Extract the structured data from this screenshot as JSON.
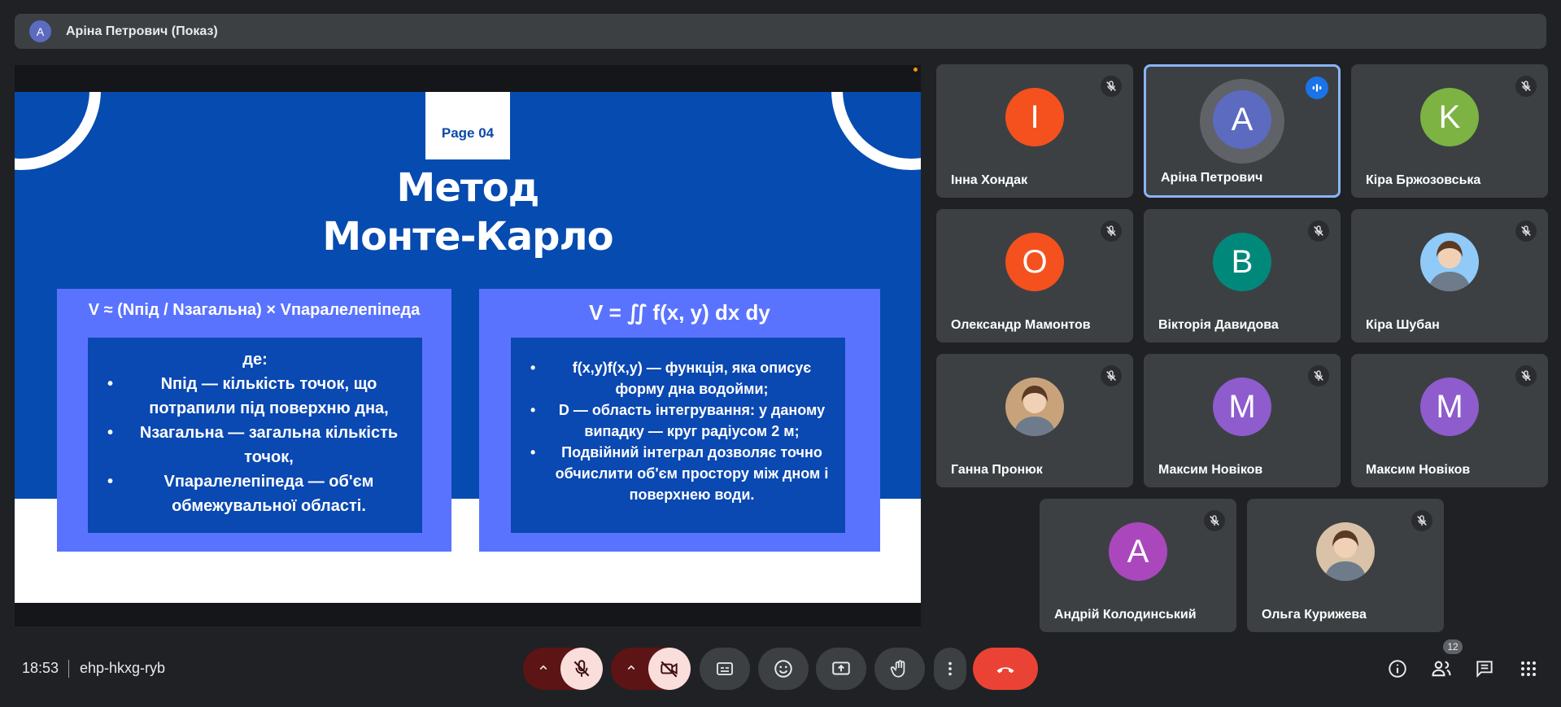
{
  "presenter_bar": {
    "avatar_letter": "A",
    "title": "Аріна Петрович (Показ)"
  },
  "slide": {
    "page_label": "Page 04",
    "title_line1": "Метод",
    "title_line2": "Монте-Карло",
    "left_panel": {
      "formula": "V ≈ (Nпід / Nзагальна) × Vпаралелепіпеда",
      "lead": "де:",
      "items": [
        "Nпід — кількість точок, що потрапили під поверхню дна,",
        "Nзагальна — загальна кількість точок,",
        "Vпаралелепіпеда — об'єм обмежувальної області."
      ]
    },
    "right_panel": {
      "formula": "V = ∬ f(x, y) dx dy",
      "items": [
        "f(x,y)f(x,y) — функція, яка описує форму дна водойми;",
        "D — область інтегрування: у даному випадку — круг радіусом 2 м;",
        "Подвійний інтеграл дозволяє точно обчислити об'єм простору між дном і поверхнею води."
      ]
    }
  },
  "participants": [
    {
      "name": "Інна Хондак",
      "letter": "I",
      "color": "#f4511e",
      "muted": true
    },
    {
      "name": "Аріна Петрович",
      "letter": "A",
      "color": "#5c6bc0",
      "speaking": true
    },
    {
      "name": "Кіра Бржозовська",
      "letter": "K",
      "color": "#7cb342",
      "muted": true
    },
    {
      "name": "Олександр Мамонтов",
      "letter": "O",
      "color": "#f4511e",
      "muted": true
    },
    {
      "name": "Вікторія Давидова",
      "letter": "B",
      "color": "#00897b",
      "muted": true
    },
    {
      "name": "Кіра Шубан",
      "letter": "",
      "color": "#90caf9",
      "muted": true,
      "photo": true
    },
    {
      "name": "Ганна Пронюк",
      "letter": "",
      "color": "#c8a27a",
      "muted": true,
      "photo": true
    },
    {
      "name": "Максим Новіков",
      "letter": "M",
      "color": "#8e5ccd",
      "muted": true
    },
    {
      "name": "Максим Новіков",
      "letter": "M",
      "color": "#8e5ccd",
      "muted": true
    },
    {
      "name": "Андрій Колодинський",
      "letter": "A",
      "color": "#ab47bc",
      "muted": true
    },
    {
      "name": "Ольга Курижева",
      "letter": "",
      "color": "#d9c2a8",
      "muted": true,
      "photo": true
    }
  ],
  "bottom_bar": {
    "time": "18:53",
    "meeting_code": "ehp-hkxg-ryb",
    "people_count": "12"
  },
  "colors": {
    "background": "#202124",
    "tile": "#3c4043",
    "end_call": "#ea4335",
    "active_border": "#8ab4f8",
    "slide_blue": "#064bb0",
    "slide_panel": "#5a73ff"
  },
  "icons": {
    "mic": "mic-off-icon",
    "camera": "camera-off-icon",
    "captions": "closed-captions-icon",
    "emoji": "emoji-icon",
    "present": "present-screen-icon",
    "hand": "raise-hand-icon",
    "more": "more-vertical-icon",
    "end": "end-call-icon",
    "info": "info-icon",
    "people": "people-icon",
    "chat": "chat-icon",
    "activities": "activities-grid-icon"
  }
}
